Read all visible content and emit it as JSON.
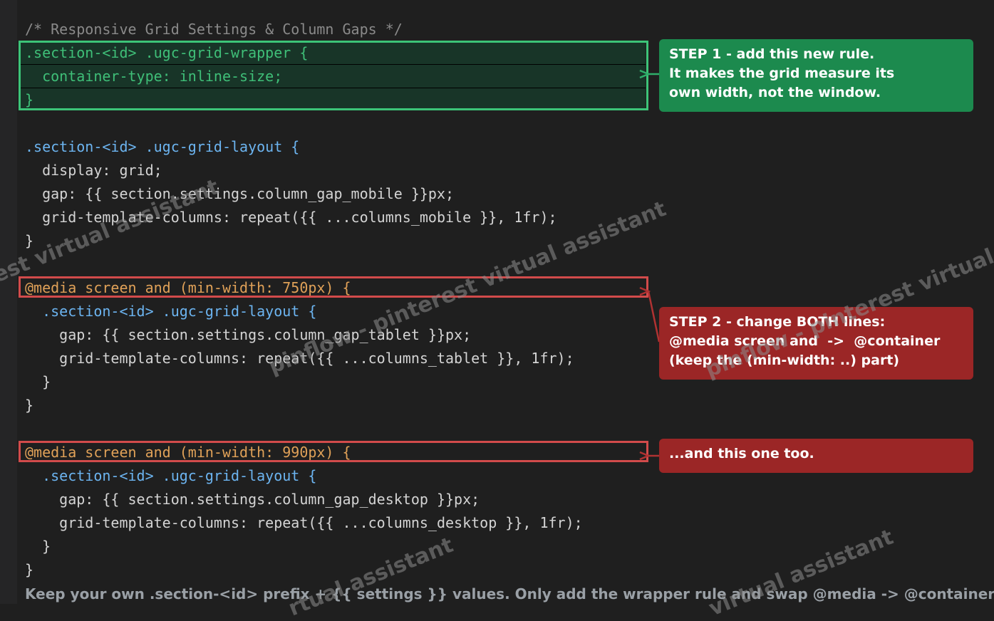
{
  "comment": "/* Responsive Grid Settings & Column Gaps */",
  "block1": [
    ".section-<id> .ugc-grid-wrapper {",
    "  container-type: inline-size;",
    "}"
  ],
  "block2": [
    ".section-<id> .ugc-grid-layout {",
    "  display: grid;",
    "  gap: {{ section.settings.column_gap_mobile }}px;",
    "  grid-template-columns: repeat({{ ...columns_mobile }}, 1fr);",
    "}"
  ],
  "block3": [
    "@media screen and (min-width: 750px) {",
    "  .section-<id> .ugc-grid-layout {",
    "    gap: {{ section.settings.column_gap_tablet }}px;",
    "    grid-template-columns: repeat({{ ...columns_tablet }}, 1fr);",
    "  }",
    "}"
  ],
  "block4": [
    "@media screen and (min-width: 990px) {",
    "  .section-<id> .ugc-grid-layout {",
    "    gap: {{ section.settings.column_gap_desktop }}px;",
    "    grid-template-columns: repeat({{ ...columns_desktop }}, 1fr);",
    "  }",
    "}"
  ],
  "callouts": {
    "step1": [
      "STEP 1 - add this new rule.",
      "It makes the grid measure its",
      "own width, not the window."
    ],
    "step2": [
      "STEP 2 - change BOTH lines:",
      "@media screen and  ->  @container",
      "(keep the (min-width: ..) part)"
    ],
    "step3": [
      "...and this one too."
    ]
  },
  "footer": "Keep your own .section-<id> prefix + {{ settings }} values. Only add the wrapper rule and swap @media -> @container",
  "watermarks": [
    "est virtual assistant",
    "pinflow - pinterest virtual assistant",
    "pinflow - pinterest virtual assistant",
    "rtual assistant",
    "virtual assistant"
  ],
  "colors": {
    "background": "#1f1f1f",
    "selector": "#6cb4f0",
    "at_rule": "#e0a158",
    "added_rule": "#3fbf78",
    "callout_green": "#1c8a4e",
    "callout_red": "#9b2626"
  }
}
